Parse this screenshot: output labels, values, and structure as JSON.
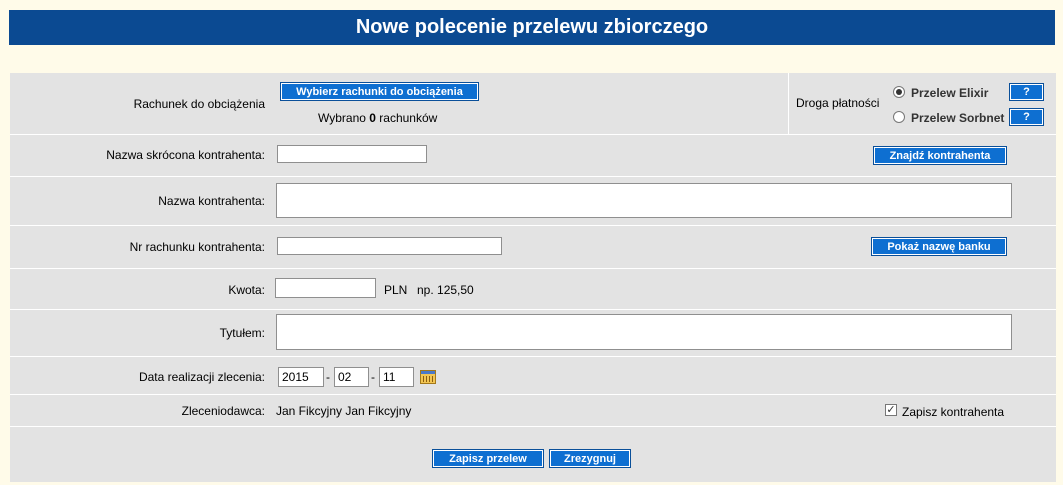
{
  "header": {
    "title": "Nowe polecenie przelewu zbiorczego"
  },
  "account": {
    "label": "Rachunek do obciążenia",
    "select_button": "Wybierz rachunki do obciążenia",
    "selected_prefix": "Wybrano ",
    "selected_count": "0",
    "selected_suffix": " rachunków"
  },
  "payment_route": {
    "label": "Droga płatności",
    "options": [
      {
        "label": "Przelew Elixir",
        "selected": true,
        "help": "?"
      },
      {
        "label": "Przelew Sorbnet",
        "selected": false,
        "help": "?"
      }
    ]
  },
  "short_name": {
    "label": "Nazwa skrócona kontrahenta:",
    "value": "",
    "find_button": "Znajdź kontrahenta"
  },
  "contractor_name": {
    "label": "Nazwa kontrahenta:",
    "value": ""
  },
  "account_number": {
    "label": "Nr rachunku kontrahenta:",
    "value": "",
    "bank_button": "Pokaż nazwę banku"
  },
  "amount": {
    "label": "Kwota:",
    "value": "",
    "currency": "PLN",
    "example": "np. 125,50"
  },
  "title": {
    "label": "Tytułem:",
    "value": ""
  },
  "execution_date": {
    "label": "Data realizacji zlecenia:",
    "year": "2015",
    "month": "02",
    "day": "11",
    "separator": "-"
  },
  "ordering_party": {
    "label": "Zleceniodawca:",
    "value": "Jan Fikcyjny Jan Fikcyjny"
  },
  "save_contractor": {
    "label": "Zapisz kontrahenta",
    "checked": true
  },
  "actions": {
    "save": "Zapisz przelew",
    "cancel": "Zrezygnuj"
  }
}
